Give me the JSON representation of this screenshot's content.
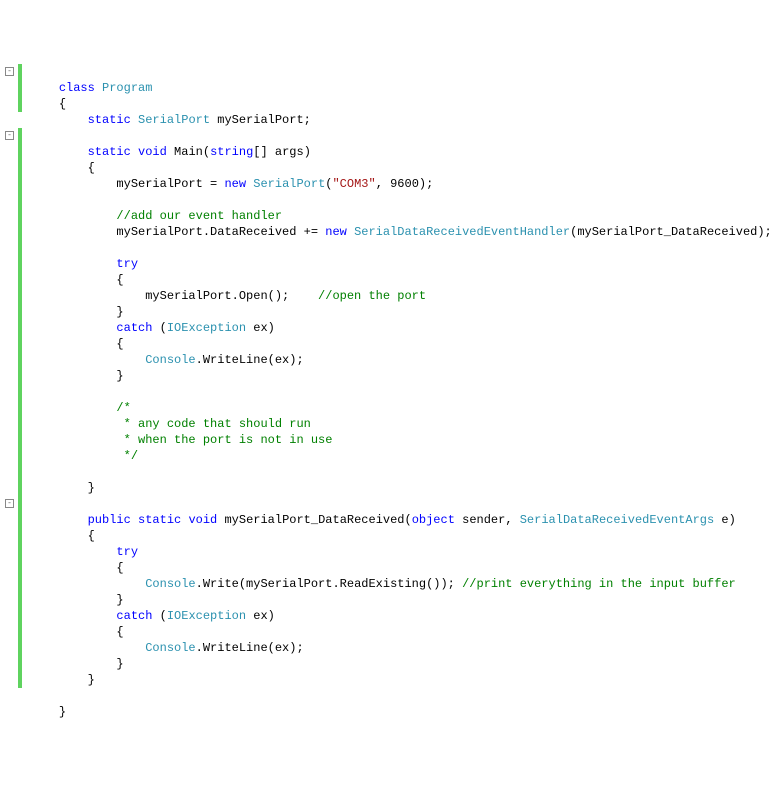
{
  "code": {
    "class_kw": "class",
    "class_name": "Program",
    "open_brace": "{",
    "close_brace": "}",
    "static_kw": "static",
    "public_kw": "public",
    "void_kw": "void",
    "new_kw": "new",
    "try_kw": "try",
    "catch_kw": "catch",
    "object_kw": "object",
    "string_arr": "string",
    "serialport_type": "SerialPort",
    "ioexception_type": "IOException",
    "console_type": "Console",
    "handler_type": "SerialDataReceivedEventHandler",
    "args_type": "SerialDataReceivedEventArgs",
    "field_name": "mySerialPort",
    "main_name": "Main",
    "args_param": "[] args)",
    "assign_new": "mySerialPort = ",
    "ctor_args_open": "(",
    "com3": "\"COM3\"",
    "ctor_args_close": ", 9600);",
    "comment_handler": "//add our event handler",
    "datarecv_line": "mySerialPort.DataReceived += ",
    "handler_call": "(mySerialPort_DataReceived);",
    "open_call": "mySerialPort.Open();    ",
    "open_comment": "//open the port",
    "catch_sig": " (",
    "ex_var": " ex)",
    "writeln": ".WriteLine(ex);",
    "block_c1": "/*",
    "block_c2": " * any code that should run",
    "block_c3": " * when the port is not in use",
    "block_c4": " */",
    "method2_name": "mySerialPort_DataReceived",
    "method2_sig_open": "(",
    "sender": " sender, ",
    "e_param": " e)",
    "write_call": ".Write(mySerialPort.ReadExisting()); ",
    "print_comment": "//print everything in the input buffer",
    "semicolon": ";",
    "brackets_args": "[] args)",
    "open_paren_main": "("
  }
}
